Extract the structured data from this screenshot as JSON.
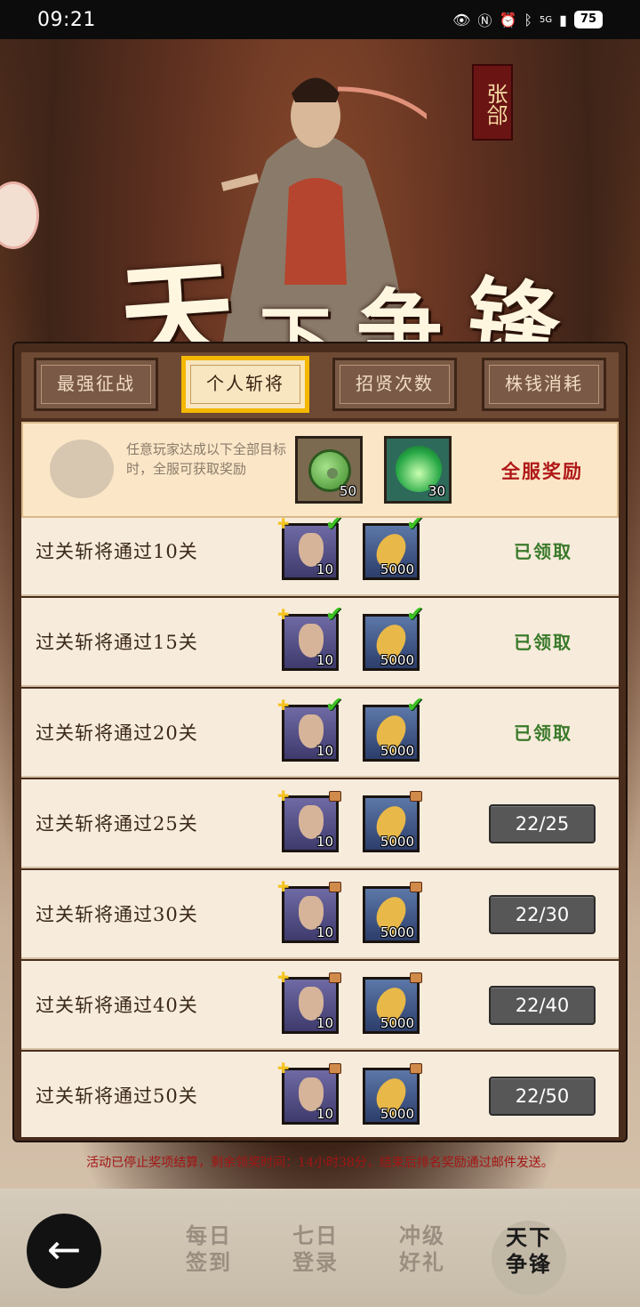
{
  "status_bar": {
    "time": "09:21",
    "icons": [
      "eye-icon",
      "nfc-icon",
      "alarm-icon",
      "bluetooth-icon",
      "signal-icon"
    ],
    "network": "5G",
    "battery": "75"
  },
  "hero": {
    "name": "张郃",
    "title_chars": [
      "天",
      "下",
      "争",
      "锋"
    ]
  },
  "tabs": [
    {
      "label": "最强征战",
      "active": false
    },
    {
      "label": "个人斩将",
      "active": true
    },
    {
      "label": "招贤次数",
      "active": false
    },
    {
      "label": "株钱消耗",
      "active": false
    }
  ],
  "server_reward": {
    "description": "任意玩家达成以下全部目标时，全服可获取奖励",
    "items": [
      {
        "icon": "jade-coin-icon",
        "count": "50"
      },
      {
        "icon": "green-flame-icon",
        "count": "30"
      }
    ],
    "label": "全服奖励"
  },
  "quests": [
    {
      "label": "过关斩将通过10关",
      "hero_count": "10",
      "grain_count": "5000",
      "claimed": true,
      "status": "已领取"
    },
    {
      "label": "过关斩将通过15关",
      "hero_count": "10",
      "grain_count": "5000",
      "claimed": true,
      "status": "已领取"
    },
    {
      "label": "过关斩将通过20关",
      "hero_count": "10",
      "grain_count": "5000",
      "claimed": true,
      "status": "已领取"
    },
    {
      "label": "过关斩将通过25关",
      "hero_count": "10",
      "grain_count": "5000",
      "claimed": false,
      "status": "22/25"
    },
    {
      "label": "过关斩将通过30关",
      "hero_count": "10",
      "grain_count": "5000",
      "claimed": false,
      "status": "22/30"
    },
    {
      "label": "过关斩将通过40关",
      "hero_count": "10",
      "grain_count": "5000",
      "claimed": false,
      "status": "22/40"
    },
    {
      "label": "过关斩将通过50关",
      "hero_count": "10",
      "grain_count": "5000",
      "claimed": false,
      "status": "22/50"
    }
  ],
  "notice": "活动已停止奖项结算，剩余领奖时间：14小时38分，结束后排名奖励通过邮件发送。",
  "bottom_nav": {
    "back_icon": "back-arrow-icon",
    "items": [
      {
        "line1": "每日",
        "line2": "签到",
        "active": false
      },
      {
        "line1": "七日",
        "line2": "登录",
        "active": false
      },
      {
        "line1": "冲级",
        "line2": "好礼",
        "active": false
      },
      {
        "line1": "天下",
        "line2": "争锋",
        "active": true
      }
    ]
  },
  "colors": {
    "active_tab_border": "#f4b800",
    "claimed_text": "#3a7a2a",
    "server_reward_label": "#b01818",
    "notice_text": "#a41414",
    "progress_button": "#575757"
  }
}
